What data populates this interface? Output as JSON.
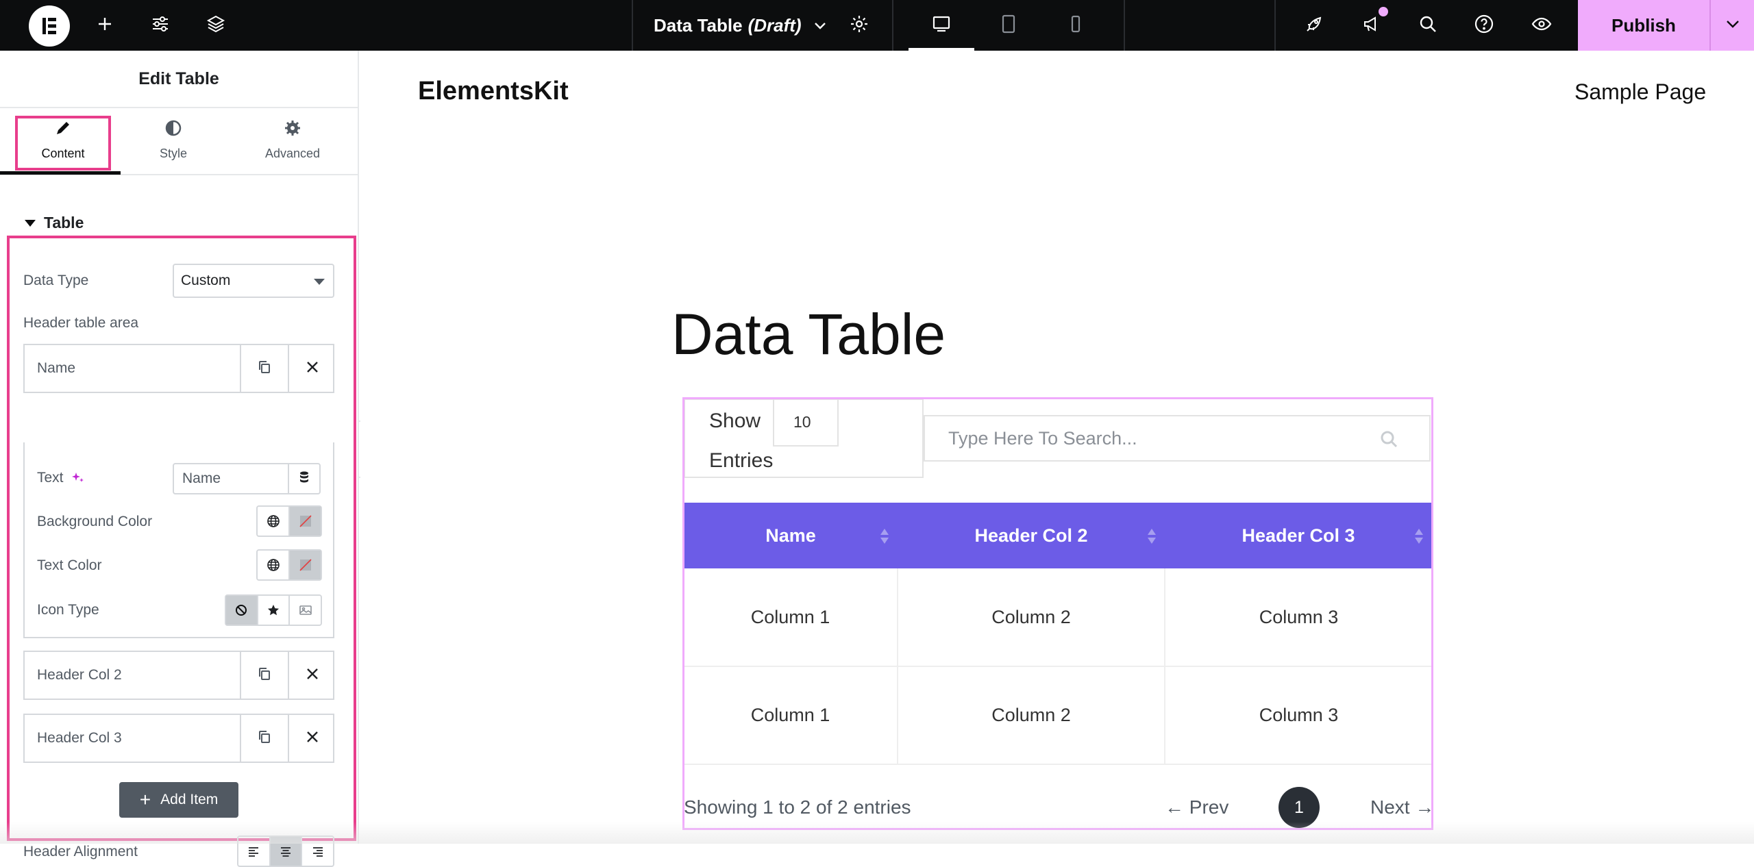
{
  "topbar": {
    "document_title": "Data Table",
    "document_status": "(Draft)",
    "publish_label": "Publish",
    "icons": [
      "elementor-logo-icon",
      "plus-icon",
      "sliders-icon",
      "layers-icon",
      "chevron-down-icon",
      "gear-icon",
      "desktop-icon",
      "tablet-icon",
      "mobile-icon",
      "rocket-icon",
      "megaphone-icon",
      "search-icon",
      "help-icon",
      "eye-icon"
    ]
  },
  "panel": {
    "title": "Edit Table",
    "tabs": [
      {
        "label": "Content",
        "icon": "pencil-icon",
        "active": true
      },
      {
        "label": "Style",
        "icon": "half-circle-icon",
        "active": false
      },
      {
        "label": "Advanced",
        "icon": "gear-icon",
        "active": false
      }
    ],
    "section_title": "Table",
    "data_type_label": "Data Type",
    "data_type_value": "Custom",
    "header_area_label": "Header table area",
    "items": [
      {
        "label": "Name"
      },
      {
        "label": "Header Col 2"
      },
      {
        "label": "Header Col 3"
      }
    ],
    "item_fields": {
      "text_label": "Text",
      "text_value": "Name",
      "bg_color_label": "Background Color",
      "text_color_label": "Text Color",
      "icon_type_label": "Icon Type"
    },
    "add_item_label": "Add Item",
    "header_alignment_label": "Header Alignment",
    "accent_color": "#e83e8c"
  },
  "canvas": {
    "site_logo": "ElementsKit",
    "nav_link": "Sample Page",
    "page_title": "Data Table",
    "table": {
      "show_label": "Show",
      "entries_label": "Entries",
      "page_length": "10",
      "search_placeholder": "Type Here To Search...",
      "headers": [
        "Name",
        "Header Col 2",
        "Header Col 3"
      ],
      "rows": [
        [
          "Column 1",
          "Column 2",
          "Column 3"
        ],
        [
          "Column 1",
          "Column 2",
          "Column 3"
        ]
      ],
      "info": "Showing 1 to 2 of 2 entries",
      "prev_label": "Prev",
      "next_label": "Next",
      "current_page": "1",
      "header_color": "#6c5ce7"
    }
  }
}
